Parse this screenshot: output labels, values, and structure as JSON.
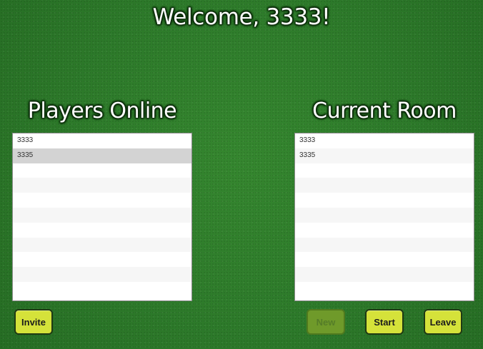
{
  "header": {
    "welcome": "Welcome, 3333!"
  },
  "players_panel": {
    "title": "Players Online",
    "rows": [
      "3333",
      "3335",
      "",
      "",
      "",
      "",
      "",
      "",
      "",
      "",
      ""
    ],
    "selected_index": 1
  },
  "room_panel": {
    "title": "Current Room",
    "rows": [
      "3333",
      "3335",
      "",
      "",
      "",
      "",
      "",
      "",
      "",
      "",
      ""
    ]
  },
  "buttons": {
    "invite": "Invite",
    "new": "New",
    "start": "Start",
    "leave": "Leave"
  },
  "colors": {
    "background": "#2f7d2c",
    "button": "#d5e23a",
    "button_disabled": "#6f9a2a",
    "selected_row": "#d3d3d3"
  }
}
